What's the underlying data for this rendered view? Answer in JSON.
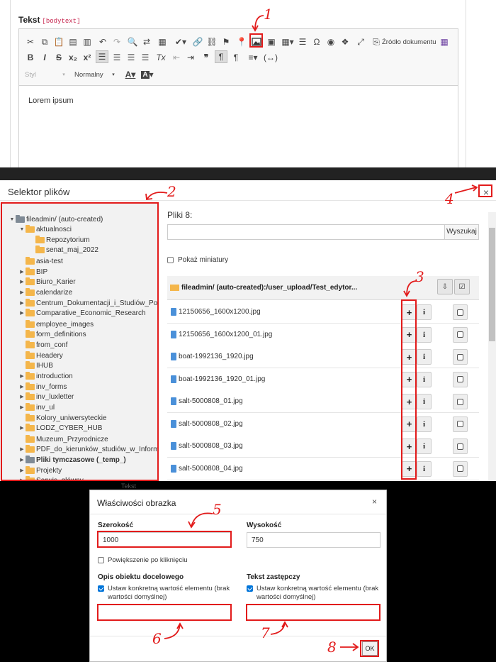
{
  "editor": {
    "field_label": "Tekst",
    "field_code": "[bodytext]",
    "source_label": "Źródło dokumentu",
    "style_select": "Styl",
    "format_select": "Normalny",
    "content": "Lorem ipsum"
  },
  "file_selector": {
    "title": "Selektor plików",
    "close": "×",
    "tree": [
      {
        "label": "fileadmin/ (auto-created)",
        "level": 0
      },
      {
        "label": "aktualnosci",
        "level": 1
      },
      {
        "label": "Repozytorium",
        "level": 2
      },
      {
        "label": "senat_maj_2022",
        "level": 2
      },
      {
        "label": "asia-test",
        "level": 1
      },
      {
        "label": "BIP",
        "level": 1
      },
      {
        "label": "Biuro_Karier",
        "level": 1
      },
      {
        "label": "calendarize",
        "level": 1
      },
      {
        "label": "Centrum_Dokumentacji_i_Studiów_Poda",
        "level": 1
      },
      {
        "label": "Comparative_Economic_Research",
        "level": 1
      },
      {
        "label": "employee_images",
        "level": 1
      },
      {
        "label": "form_definitions",
        "level": 1
      },
      {
        "label": "from_conf",
        "level": 1
      },
      {
        "label": "Headery",
        "level": 1
      },
      {
        "label": "IHUB",
        "level": 1
      },
      {
        "label": "introduction",
        "level": 1
      },
      {
        "label": "inv_forms",
        "level": 1
      },
      {
        "label": "inv_luxletter",
        "level": 1
      },
      {
        "label": "inv_ul",
        "level": 1
      },
      {
        "label": "Kolory_uniwersyteckie",
        "level": 1
      },
      {
        "label": "LODZ_CYBER_HUB",
        "level": 1
      },
      {
        "label": "Muzeum_Przyrodnicze",
        "level": 1
      },
      {
        "label": "PDF_do_kierunków_studiów_w_Informa",
        "level": 1
      },
      {
        "label": "Pliki tymczasowe (_temp_)",
        "level": 1
      },
      {
        "label": "Projekty",
        "level": 1
      },
      {
        "label": "Serwis_główny",
        "level": 1
      }
    ],
    "files_count": "Pliki 8:",
    "search_button": "Wyszukaj",
    "show_thumbnails": "Pokaż miniatury",
    "path": "fileadmin/ (auto-created):/user_upload/Test_edytor...",
    "files": [
      "12150656_1600x1200.jpg",
      "12150656_1600x1200_01.jpg",
      "boat-1992136_1920.jpg",
      "boat-1992136_1920_01.jpg",
      "salt-5000808_01.jpg",
      "salt-5000808_02.jpg",
      "salt-5000808_03.jpg",
      "salt-5000808_04.jpg"
    ],
    "add_symbol": "+",
    "info_symbol": "i"
  },
  "image_props": {
    "title": "Właściwości obrazka",
    "close": "×",
    "width_label": "Szerokość",
    "width_value": "1000",
    "height_label": "Wysokość",
    "height_value": "750",
    "zoom_label": "Powiększenie po kliknięciu",
    "desc_label": "Opis obiektu docelowego",
    "desc_check": "Ustaw konkretną wartość elementu (brak wartości domyślnej)",
    "alt_label": "Tekst zastępczy",
    "alt_check": "Ustaw konkretną wartość elementu (brak wartości domyślnej)",
    "ok_button": "OK",
    "behind_text": "Tekst"
  },
  "annotations": [
    "1",
    "2",
    "3",
    "4",
    "5",
    "6",
    "7",
    "8"
  ],
  "colors": {
    "annotation": "#e21b1b",
    "folder": "#f4b64b",
    "file_icon": "#4a90d9"
  }
}
